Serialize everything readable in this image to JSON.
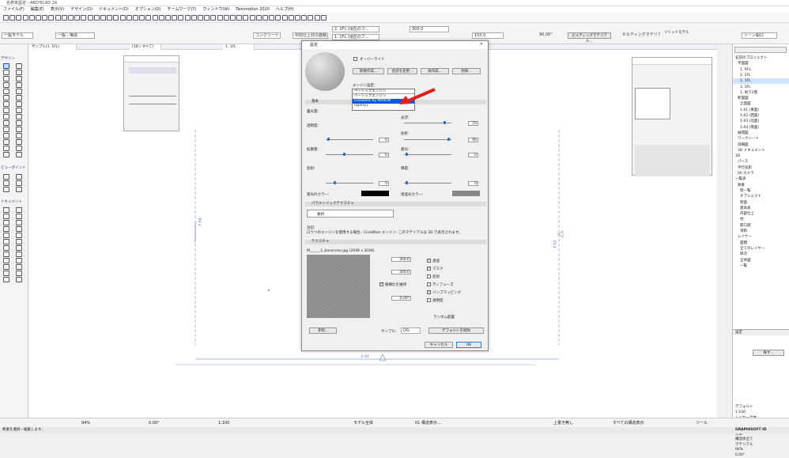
{
  "app": {
    "title": "名称未設定 - ARCHICAD 24"
  },
  "menu": [
    "ファイル(F)",
    "編集(E)",
    "表示(V)",
    "デザイン(D)",
    "ドキュメント(D)",
    "オプション(O)",
    "チームワーク(T)",
    "ウィンドウ(W)",
    "Twinmotion 2020",
    "ヘルプ(H)"
  ],
  "info": {
    "layer": "一般モデル",
    "building_material": "一般 - 構造",
    "story_label": "2. 2FL (現在のフ...",
    "story_num": "300.0",
    "storey1": "1. 1FL (現在のフ...",
    "structure": "コンクリート",
    "offset": "150.0",
    "angle": "90.00°",
    "composite": "中間仕上材の面積...",
    "finish": "ビルディングマテリアル",
    "bm_btn": "ビルディングマテリアル...",
    "right1": "ソリッドモデル",
    "right2": "ソーン開口"
  },
  "viewtabs": [
    "[3D / すべて]",
    "サンプル(1. 1FL)",
    "1. 1FL"
  ],
  "drawing": {
    "marker_left": "F-04",
    "marker_right": "F-02",
    "marker_bottom": "F-01"
  },
  "toolbox": {
    "sections": [
      "デザイン",
      "ビューポイント",
      "ドキュメント"
    ]
  },
  "dialog": {
    "title": "設定",
    "override": "オーバーライド",
    "buttons": {
      "new": "新規作成...",
      "rename": "名前を変更...",
      "dup": "再作成...",
      "delete": "削除..."
    },
    "engine_label": "エンジン設定:",
    "engine_options": [
      "ベーシックエンジン",
      "ベーシックエンジン",
      "Cineware by MAXON",
      "OpenGL"
    ],
    "engine_selected": "Cineware by MAXON",
    "sections": {
      "surface": "基本",
      "legacy": "パラメトリックテクスチャ",
      "texture": "テクスチャ"
    },
    "labels": {
      "exposure": "露光量:",
      "reflect": "光沢:",
      "transp": "透明度:",
      "shine": "反射:",
      "color": "色合い:",
      "refract": "屈折:",
      "emit": "発光:",
      "diffuse": "拡散量:",
      "ambient": "環境光:",
      "lum": "輝度:",
      "emitcolor": "発光のカラー:",
      "transcolor": "透過光カラー:",
      "specular": "スペキュラ:",
      "mat": "素材"
    },
    "values": {
      "v1": "70",
      "v2": "90",
      "v3": "0",
      "v4": "0",
      "v5": "0",
      "v6": "0"
    },
    "note": "注記:\nロウツのエンジンを使用する場合、CineWare エンジン: このマテリアルは 3D で表示されます。",
    "texture_file": "M______1_basecolor.jpg (2048 x 2048)",
    "tex_w": "300.0",
    "tex_h": "300.0",
    "tex_angle": "0.00°",
    "tex_opts": [
      "透過",
      "マスク",
      "反射",
      "ディフューズ",
      "バンプマッピング",
      "透明度"
    ],
    "tex_keep": "縦横比を維持",
    "tex_search": "参照...",
    "random": "ランダム配置",
    "sample_label": "サンプル:",
    "sample_val": "DG",
    "reset_btn": "デフォルトを削除",
    "cancel": "キャンセル",
    "ok": "OK"
  },
  "nav": {
    "items": [
      "名前のプロジェクト",
      "平面図",
      "1. RFL",
      "2. 2FL",
      "1. 1FL",
      "3. 3FL",
      "1. 地下2階",
      "断面図",
      "立面図",
      "1-01 (東面)",
      "1-02 (西面)",
      "1-03 (北面)",
      "1-04 (南面)",
      "展開図",
      "ワークシート",
      "詳細図",
      "3D ドキュメント",
      "3D",
      "パース",
      "平行投影",
      "00 カメラ",
      "一覧表",
      "要素",
      "壁一覧",
      "オブジェクト",
      "壁面",
      "建具表",
      "内部仕上",
      "柱",
      "開口部",
      "項目",
      "レイヤー",
      "面積",
      "全てのレイヤー",
      "目次",
      "全体図",
      "一覧"
    ],
    "selected": "1. 1FL",
    "props": [
      "デフォルト",
      "1:100",
      "レイヤー全体",
      "全て",
      "デフォルト",
      "上面",
      "構造体全て",
      "マテリアル",
      "94%",
      "0.00°"
    ],
    "tag": "設定",
    "search": "探す..."
  },
  "status": {
    "zoom": "94%",
    "angle": "0.00°",
    "scale": "1:100",
    "layers": "モデル全体",
    "pen": "01 構造表示...",
    "opt1": "上書き無し",
    "opt2": "すべての構造表示",
    "opt3": "ツール"
  },
  "bottom": {
    "left": "要素を選択・編集します。",
    "logo": "GRAPHISOFT ID"
  }
}
